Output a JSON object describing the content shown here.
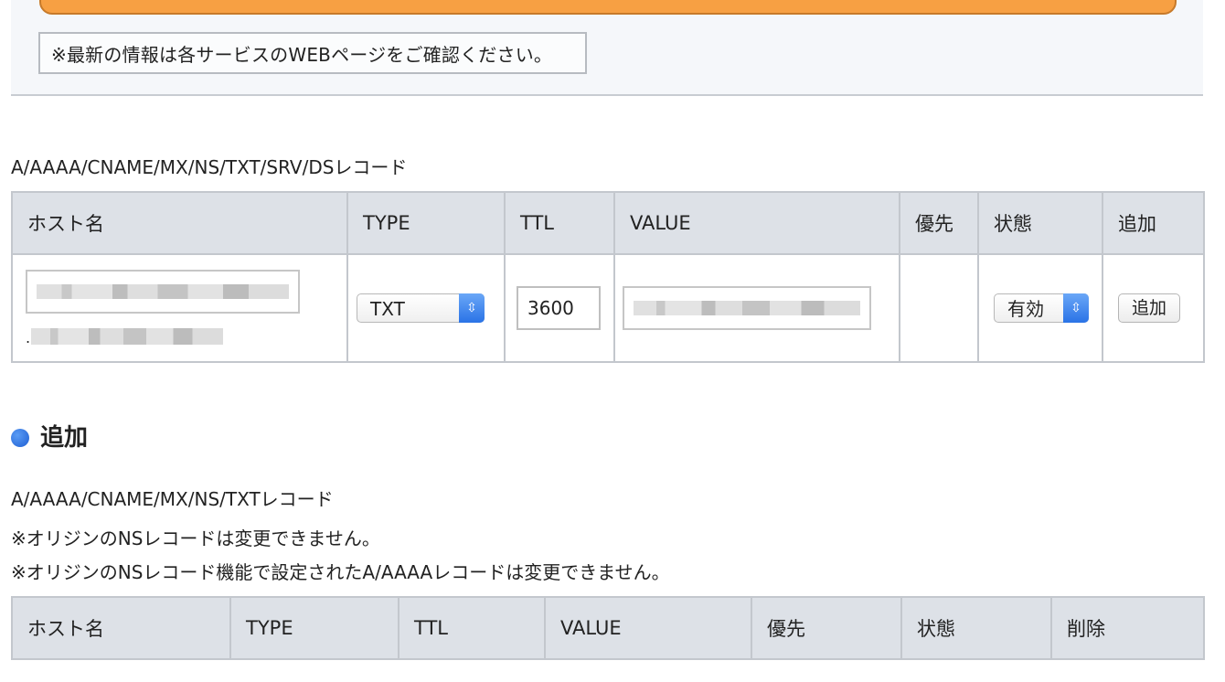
{
  "notice": "※最新の情報は各サービスのWEBページをご確認ください。",
  "add_section": {
    "label": "A/AAAA/CNAME/MX/NS/TXT/SRV/DSレコード",
    "headers": [
      "ホスト名",
      "TYPE",
      "TTL",
      "VALUE",
      "優先",
      "状態",
      "追加"
    ],
    "row": {
      "type_value": "TXT",
      "ttl_value": "3600",
      "priority_value": "",
      "status_value": "有効",
      "domain_prefix": ".",
      "add_button": "追加"
    }
  },
  "list_section": {
    "heading": "追加",
    "label": "A/AAAA/CNAME/MX/NS/TXTレコード",
    "note1": "※オリジンのNSレコードは変更できません。",
    "note2": "※オリジンのNSレコード機能で設定されたA/AAAAレコードは変更できません。",
    "headers": [
      "ホスト名",
      "TYPE",
      "TTL",
      "VALUE",
      "優先",
      "状態",
      "削除"
    ]
  },
  "colors": {
    "accent_orange": "#f7a043",
    "header_bg": "#dde1e7",
    "bullet_blue": "#1f5fd3"
  }
}
